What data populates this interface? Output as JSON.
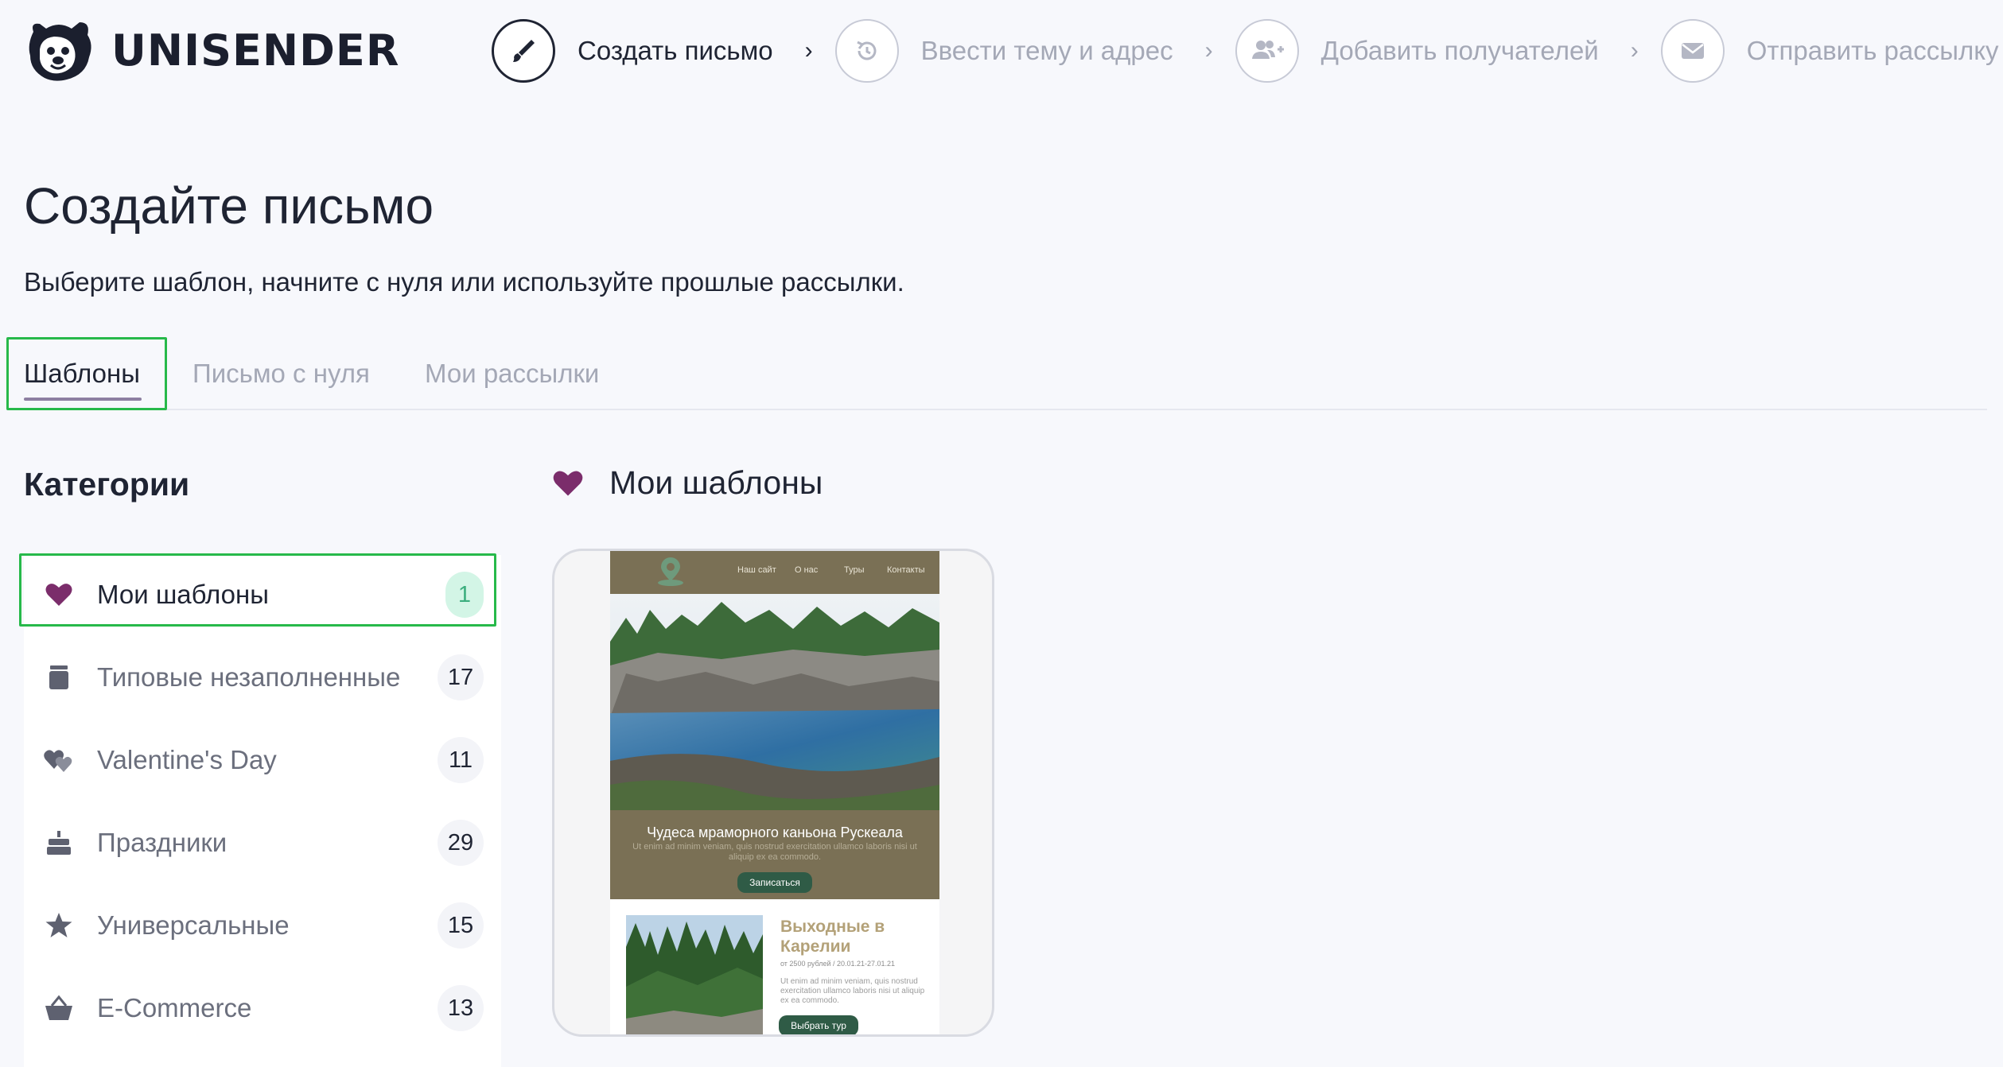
{
  "brand": {
    "name": "UNISENDER"
  },
  "steps": [
    {
      "label": "Создать письмо",
      "icon": "brush-icon",
      "active": true
    },
    {
      "label": "Ввести тему и адрес",
      "icon": "refresh-icon",
      "active": false
    },
    {
      "label": "Добавить получателей",
      "icon": "add-users-icon",
      "active": false
    },
    {
      "label": "Отправить рассылку",
      "icon": "envelope-icon",
      "active": false
    }
  ],
  "step_separator": "›",
  "page": {
    "title": "Создайте письмо",
    "subtitle": "Выберите шаблон, начните с нуля или используйте прошлые рассылки."
  },
  "tabs": [
    {
      "label": "Шаблоны",
      "active": true
    },
    {
      "label": "Письмо с нуля",
      "active": false
    },
    {
      "label": "Мои рассылки",
      "active": false
    }
  ],
  "categories": {
    "title": "Категории",
    "items": [
      {
        "label": "Мои шаблоны",
        "count": "1",
        "icon": "heart-icon",
        "active": true
      },
      {
        "label": "Типовые незаполненные",
        "count": "17",
        "icon": "jar-icon",
        "active": false
      },
      {
        "label": "Valentine's Day",
        "count": "11",
        "icon": "hearts-icon",
        "active": false
      },
      {
        "label": "Праздники",
        "count": "29",
        "icon": "cake-icon",
        "active": false
      },
      {
        "label": "Универсальные",
        "count": "15",
        "icon": "star-icon",
        "active": false
      },
      {
        "label": "E-Commerce",
        "count": "13",
        "icon": "basket-icon",
        "active": false
      }
    ]
  },
  "templates": {
    "heading": "Мои шаблоны",
    "cards": [
      {
        "nav": [
          "Наш сайт",
          "О нас",
          "Туры",
          "Контакты"
        ],
        "hero_title": "Чудеса мраморного каньона Рускеала",
        "hero_text": "Ut enim ad minim veniam, quis nostrud exercitation ullamco laboris nisi ut aliquip ex ea commodo.",
        "hero_button": "Записаться",
        "section_title": "Выходные в Карелии",
        "section_price": "от 2500 рублей / 20.01.21-27.01.21",
        "section_text": "Ut enim ad minim veniam, quis nostrud exercitation ullamco laboris nisi ut aliquip ex ea commodo.",
        "section_button": "Выбрать тур"
      }
    ]
  },
  "colors": {
    "accent_green": "#27b94a",
    "heart_purple": "#7b2d6b",
    "email_brown": "#7a7055",
    "email_button": "#2f5b46"
  }
}
